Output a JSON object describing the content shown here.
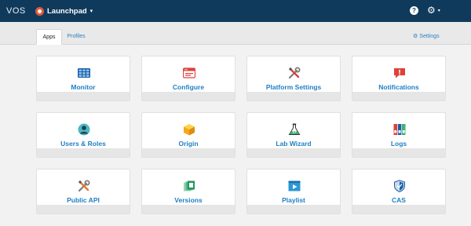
{
  "header": {
    "brand": "VOS",
    "app_name": "Launchpad",
    "caret": "▾",
    "help": "?",
    "gear": "⚙",
    "gear_caret": "▾"
  },
  "tabs": [
    {
      "label": "Apps",
      "active": true
    },
    {
      "label": "Profiles",
      "active": false
    }
  ],
  "settings_link": {
    "icon": "⚙",
    "label": "Settings"
  },
  "apps": [
    {
      "label": "Monitor",
      "icon": "monitor-grid-icon"
    },
    {
      "label": "Configure",
      "icon": "browser-window-icon"
    },
    {
      "label": "Platform Settings",
      "icon": "wrench-screwdriver-icon"
    },
    {
      "label": "Notifications",
      "icon": "alert-bubble-icon"
    },
    {
      "label": "Users & Roles",
      "icon": "user-avatar-icon"
    },
    {
      "label": "Origin",
      "icon": "cube-icon"
    },
    {
      "label": "Lab Wizard",
      "icon": "flask-icon"
    },
    {
      "label": "Logs",
      "icon": "binders-icon"
    },
    {
      "label": "Public API",
      "icon": "wrench-screwdriver-icon"
    },
    {
      "label": "Versions",
      "icon": "stacked-pages-icon"
    },
    {
      "label": "Playlist",
      "icon": "play-list-icon"
    },
    {
      "label": "CAS",
      "icon": "shield-icon"
    }
  ],
  "colors": {
    "header_bg": "#0f3a5c",
    "link": "#2a7fc1",
    "card_label": "#1f7fc4"
  }
}
